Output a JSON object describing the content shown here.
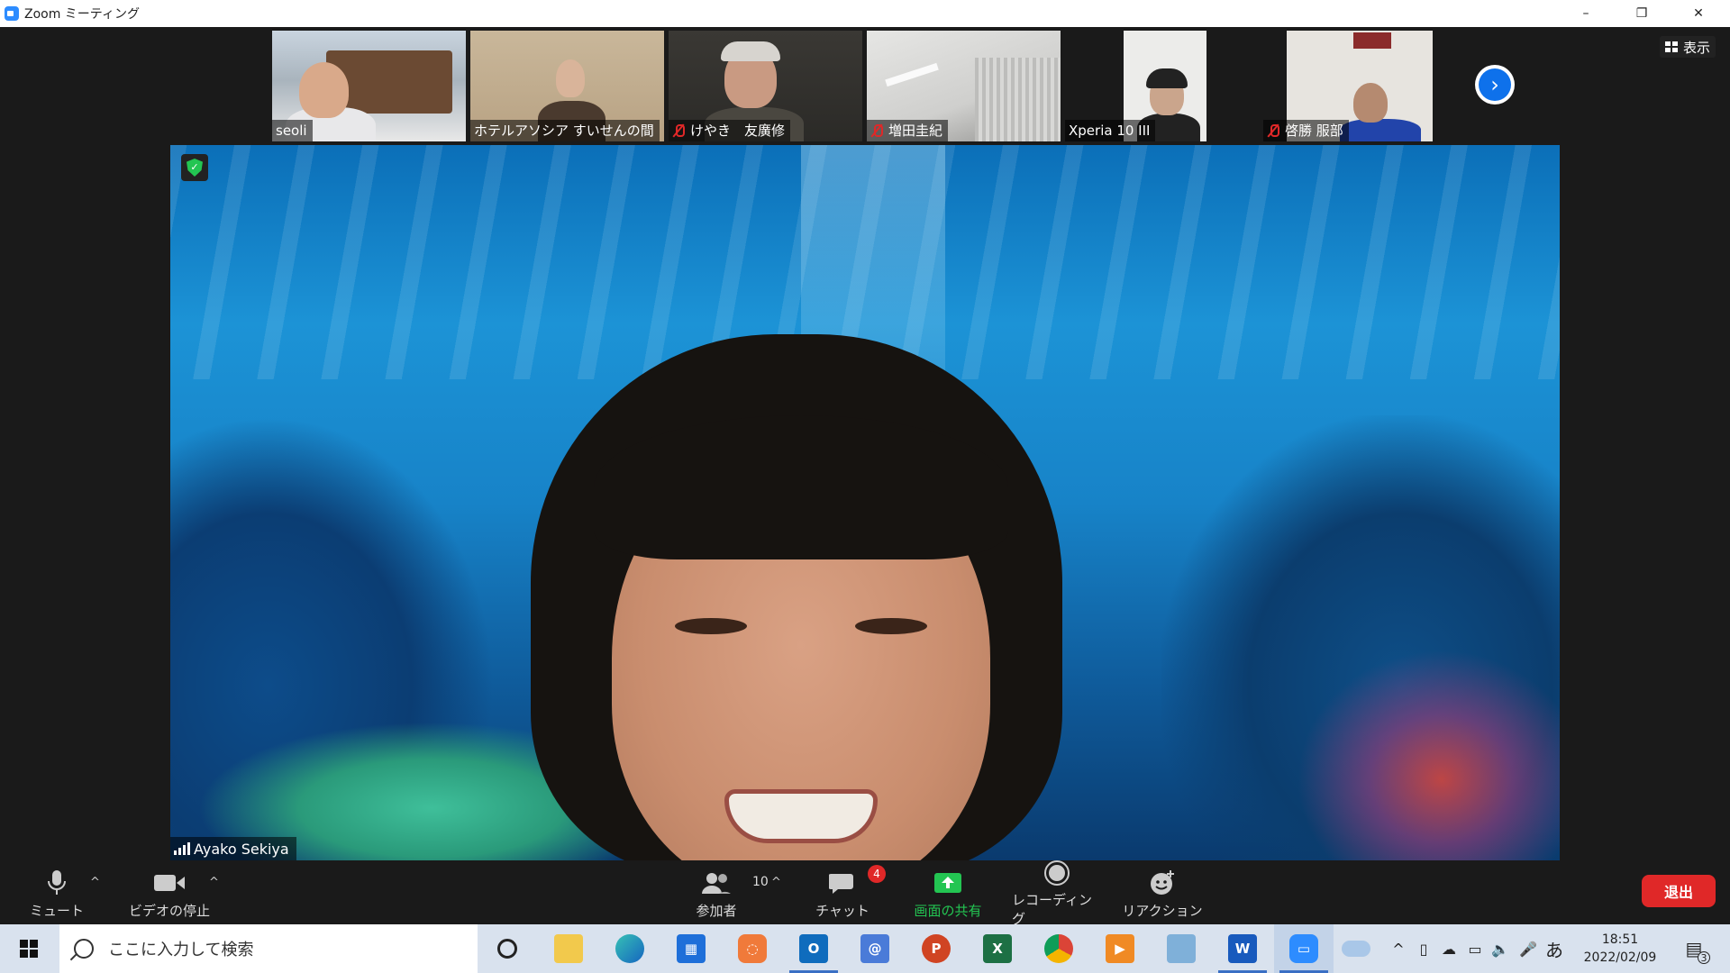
{
  "window": {
    "title": "Zoom ミーティング",
    "controls": {
      "minimize": "–",
      "restore": "❐",
      "close": "✕"
    }
  },
  "gallery": {
    "participants": [
      {
        "name": "seoli",
        "muted": false
      },
      {
        "name": "ホテルアソシア すいせんの間",
        "muted": false
      },
      {
        "name": "けやき　友廣修",
        "muted": true
      },
      {
        "name": "増田圭紀",
        "muted": true
      },
      {
        "name": "Xperia 10 III",
        "muted": false
      },
      {
        "name": "啓勝 服部",
        "muted": true
      }
    ],
    "view_label": "表示",
    "next_icon": "chevron-right-icon"
  },
  "main": {
    "speaker_name": "Ayako Sekiya"
  },
  "toolbar": {
    "mute_label": "ミュート",
    "video_label": "ビデオの停止",
    "participants_label": "参加者",
    "participants_count": "10",
    "chat_label": "チャット",
    "chat_badge": "4",
    "share_label": "画面の共有",
    "record_label": "レコーディング",
    "reaction_label": "リアクション",
    "leave_label": "退出"
  },
  "taskbar": {
    "search_placeholder": "ここに入力して検索",
    "time": "18:51",
    "date": "2022/02/09",
    "ime": "あ",
    "notification_count": "3",
    "apps": [
      "cortana",
      "file-explorer",
      "edge",
      "store",
      "app",
      "outlook",
      "mail",
      "powerpoint",
      "excel",
      "chrome",
      "player",
      "desktop",
      "word",
      "zoom",
      "onedrive"
    ]
  },
  "colors": {
    "accent": "#0e71eb",
    "leave": "#e02828",
    "share": "#23c552",
    "muted": "#e02828"
  }
}
